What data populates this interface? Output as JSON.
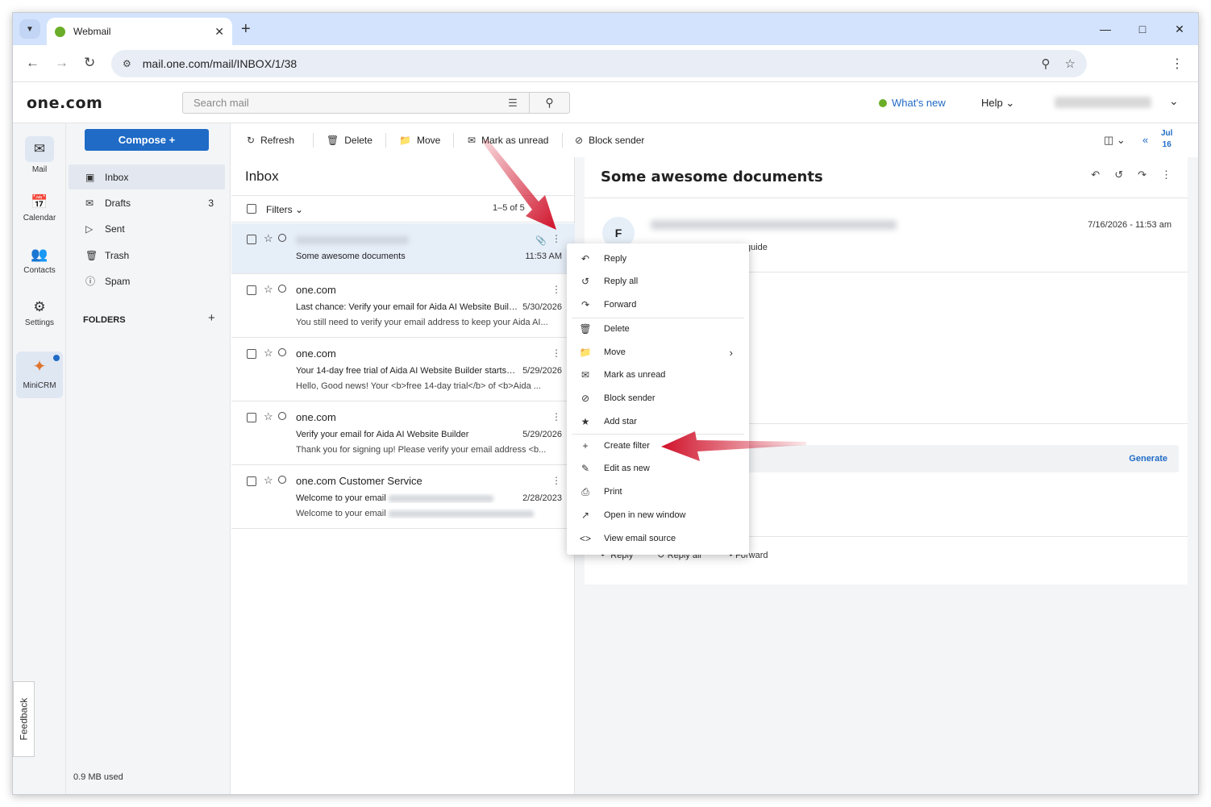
{
  "browser": {
    "tab_title": "Webmail",
    "url": "mail.one.com/mail/INBOX/1/38"
  },
  "header": {
    "logo": "one.com",
    "search_placeholder": "Search mail",
    "whats_new": "What's new",
    "help": "Help"
  },
  "rail": {
    "mail": "Mail",
    "calendar": "Calendar",
    "contacts": "Contacts",
    "settings": "Settings",
    "minicrm": "MiniCRM",
    "feedback": "Feedback"
  },
  "folders": {
    "compose": "Compose +",
    "items": [
      {
        "label": "Inbox",
        "count": ""
      },
      {
        "label": "Drafts",
        "count": "3"
      },
      {
        "label": "Sent",
        "count": ""
      },
      {
        "label": "Trash",
        "count": ""
      },
      {
        "label": "Spam",
        "count": ""
      }
    ],
    "folders_heading": "FOLDERS",
    "usage": "0.9 MB used"
  },
  "actions": {
    "refresh": "Refresh",
    "delete": "Delete",
    "move": "Move",
    "mark_unread": "Mark as unread",
    "block_sender": "Block sender",
    "date_month": "Jul",
    "date_day": "16"
  },
  "list": {
    "title": "Inbox",
    "filters": "Filters",
    "range": "1–5 of 5",
    "messages": [
      {
        "sender": "",
        "subject": "Some awesome documents",
        "date": "11:53 AM",
        "preview": ""
      },
      {
        "sender": "one.com",
        "subject": "Last chance: Verify your email for Aida AI Website Builder",
        "date": "5/30/2026",
        "preview": "You still need to verify your email address to keep your Aida AI..."
      },
      {
        "sender": "one.com",
        "subject": "Your 14-day free trial of Aida AI Website Builder starts now",
        "date": "5/29/2026",
        "preview": "Hello, Good news! Your <b>free 14-day trial</b> of <b>Aida ..."
      },
      {
        "sender": "one.com",
        "subject": "Verify your email for Aida AI Website Builder",
        "date": "5/29/2026",
        "preview": "Thank you for signing up! Please verify your email address <b..."
      },
      {
        "sender": "one.com Customer Service",
        "subject": "Welcome to your email",
        "date": "2/28/2023",
        "preview": "Welcome to your email"
      }
    ]
  },
  "reading": {
    "subject": "Some awesome documents",
    "avatar": "F",
    "date": "7/16/2026  -  11:53 am",
    "to_fragment": "guide",
    "generate": "Generate",
    "reply": "Reply",
    "reply_all": "Reply all",
    "forward": "Forward"
  },
  "context_menu": {
    "items": [
      "Reply",
      "Reply all",
      "Forward",
      "Delete",
      "Move",
      "Mark as unread",
      "Block sender",
      "Add star",
      "Create filter",
      "Edit as new",
      "Print",
      "Open in new window",
      "View email source"
    ]
  },
  "colors": {
    "accent": "#1f6bc6",
    "brand_green": "#6aad28",
    "annotation_arrow": "#d0122a"
  }
}
